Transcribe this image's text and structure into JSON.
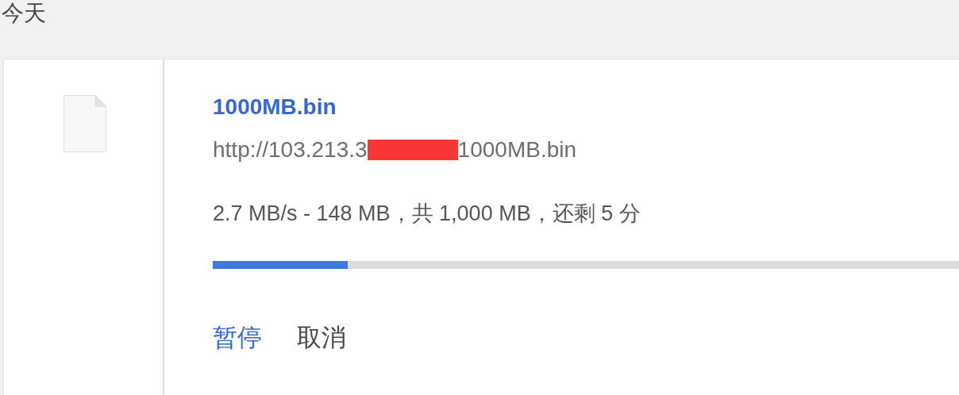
{
  "section_title": "今天",
  "download": {
    "file_name": "1000MB.bin",
    "url_start": "http://103.213.3",
    "url_end": "1000MB.bin",
    "status": "2.7 MB/s - 148 MB，共 1,000 MB，还剩 5 分",
    "level": 0.148,
    "actions": [
      {
        "label": "暂停",
        "kind": "primary"
      },
      {
        "label": "取消",
        "kind": "secondary"
      }
    ]
  }
}
